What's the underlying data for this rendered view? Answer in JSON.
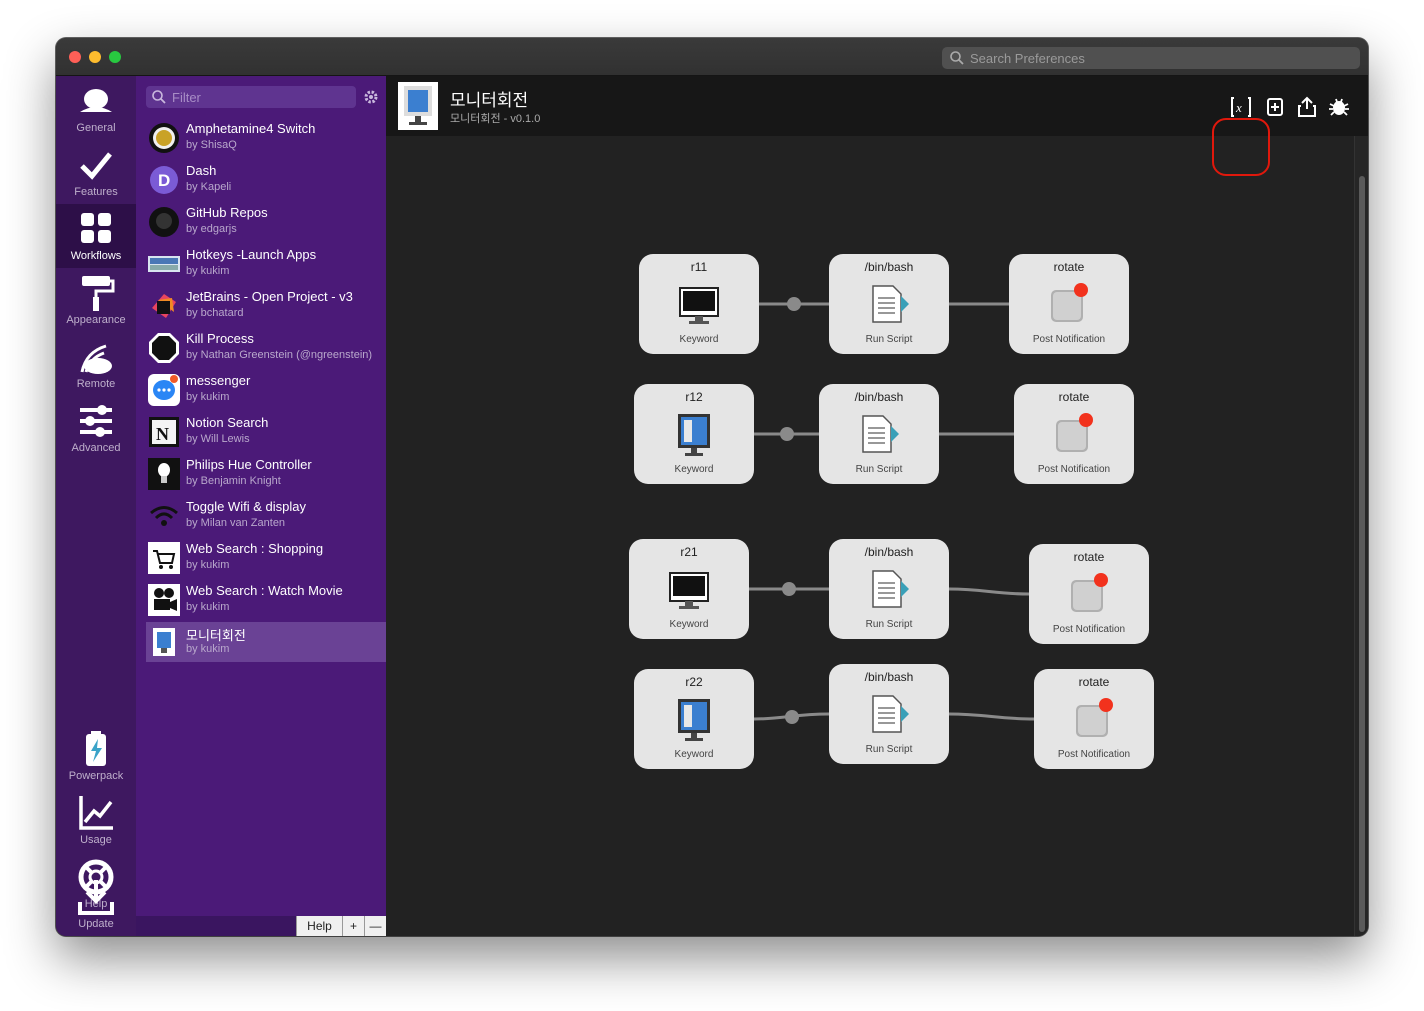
{
  "window": {
    "search_placeholder": "Search Preferences"
  },
  "nav": {
    "items": [
      {
        "label": "General",
        "icon": "person-icon"
      },
      {
        "label": "Features",
        "icon": "checkmark-icon"
      },
      {
        "label": "Workflows",
        "icon": "grid-icon"
      },
      {
        "label": "Appearance",
        "icon": "paint-roller-icon"
      },
      {
        "label": "Remote",
        "icon": "remote-icon"
      },
      {
        "label": "Advanced",
        "icon": "sliders-icon"
      },
      {
        "label": "Powerpack",
        "icon": "battery-icon"
      },
      {
        "label": "Usage",
        "icon": "chart-icon"
      },
      {
        "label": "Help",
        "icon": "lifebuoy-icon"
      },
      {
        "label": "Update",
        "icon": "download-icon"
      }
    ]
  },
  "list": {
    "filter_placeholder": "Filter",
    "workflows": [
      {
        "title": "Amphetamine4 Switch",
        "author": "by ShisaQ"
      },
      {
        "title": "Dash",
        "author": "by Kapeli"
      },
      {
        "title": "GitHub Repos",
        "author": "by edgarjs"
      },
      {
        "title": "Hotkeys -Launch Apps",
        "author": "by kukim"
      },
      {
        "title": "JetBrains - Open Project - v3",
        "author": "by bchatard"
      },
      {
        "title": "Kill Process",
        "author": "by Nathan Greenstein (@ngreenstein)"
      },
      {
        "title": "messenger",
        "author": "by kukim"
      },
      {
        "title": "Notion Search",
        "author": "by Will Lewis"
      },
      {
        "title": "Philips Hue Controller",
        "author": "by Benjamin Knight"
      },
      {
        "title": "Toggle Wifi & display",
        "author": "by Milan van Zanten"
      },
      {
        "title": "Web Search : Shopping",
        "author": "by kukim"
      },
      {
        "title": "Web Search : Watch Movie",
        "author": "by kukim"
      },
      {
        "title": "모니터회전",
        "author": "by kukim"
      }
    ],
    "footer": {
      "help": "Help",
      "add": "+",
      "remove": "—"
    }
  },
  "main": {
    "title": "모니터회전",
    "subtitle": "모니터회전 - v0.1.0",
    "toolbar": [
      "variables-icon",
      "add-object-icon",
      "share-icon",
      "debug-icon"
    ],
    "rows": [
      {
        "keyword": {
          "title": "r11",
          "type": "Keyword",
          "icon": "monitor-icon"
        },
        "script": {
          "title": "/bin/bash",
          "type": "Run Script"
        },
        "notify": {
          "title": "rotate",
          "type": "Post Notification"
        }
      },
      {
        "keyword": {
          "title": "r12",
          "type": "Keyword",
          "icon": "workflow-icon"
        },
        "script": {
          "title": "/bin/bash",
          "type": "Run Script"
        },
        "notify": {
          "title": "rotate",
          "type": "Post Notification"
        }
      },
      {
        "keyword": {
          "title": "r21",
          "type": "Keyword",
          "icon": "monitor-icon"
        },
        "script": {
          "title": "/bin/bash",
          "type": "Run Script"
        },
        "notify": {
          "title": "rotate",
          "type": "Post Notification"
        }
      },
      {
        "keyword": {
          "title": "r22",
          "type": "Keyword",
          "icon": "workflow-icon"
        },
        "script": {
          "title": "/bin/bash",
          "type": "Run Script"
        },
        "notify": {
          "title": "rotate",
          "type": "Post Notification"
        }
      }
    ]
  },
  "colors": {
    "sidebar": "#3e1860",
    "list": "#4b1a78",
    "selected": "#6a4295",
    "canvas": "#222222",
    "highlight": "#e0180c"
  }
}
